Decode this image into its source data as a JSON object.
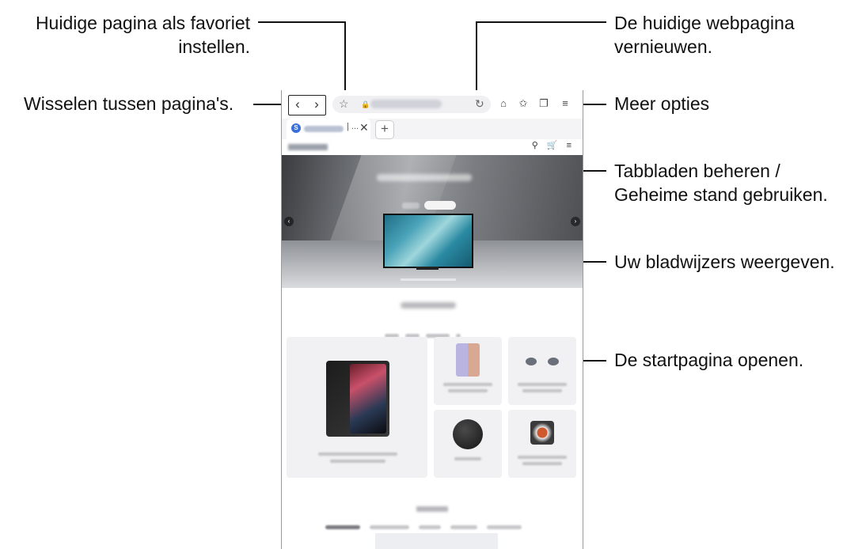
{
  "callouts": {
    "favorite": "Huidige pagina als favoriet\ninstellen.",
    "switch_pages": "Wisselen tussen pagina's.",
    "refresh": "De huidige webpagina\nvernieuwen.",
    "more_options": "Meer opties",
    "tabs": "Tabbladen beheren /\nGeheime stand gebruiken.",
    "bookmarks": "Uw bladwijzers weergeven.",
    "home": "De startpagina openen."
  },
  "browser": {
    "back_icon": "‹",
    "forward_icon": "›",
    "star_icon": "☆",
    "reload_icon": "↻",
    "home_icon": "⌂",
    "bookmarks_icon": "✩",
    "tabs_icon": "❐",
    "menu_icon": "≡",
    "tab_favicon": "S",
    "tab_dots": "| ...",
    "tab_close": "✕",
    "new_tab": "+",
    "site_icons": "⚲ 🛒 ≡"
  },
  "colors": {
    "text": "#111111",
    "frame": "#999999",
    "accent": "#3a6fd8"
  }
}
